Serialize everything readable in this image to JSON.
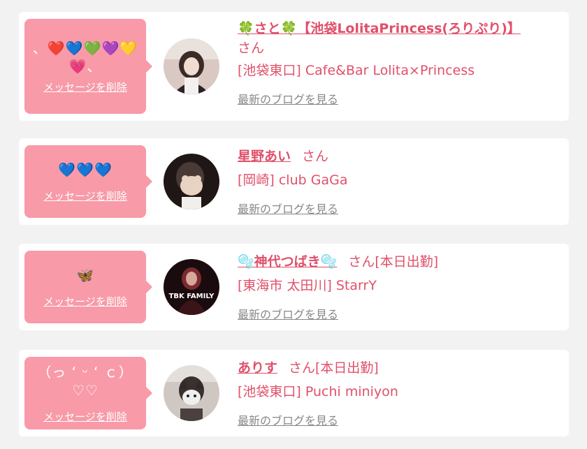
{
  "delete_label": "メッセージを削除",
  "blog_label": "最新のブログを見る",
  "colors": {
    "accent": "#e0506a",
    "bubble": "#f89aa8",
    "background": "#f2f2f3"
  },
  "items": [
    {
      "message": "、❤️💙💚💜💛 💗、",
      "name": "🍀さと🍀【池袋LolitaPrincess(ろりぷり)】",
      "honorific": "さん",
      "shop": "[池袋東口] Cafe&Bar Lolita×Princess"
    },
    {
      "message": "💙💙💙",
      "name": "星野あい",
      "honorific": "さん",
      "shop": "[岡崎] club GaGa"
    },
    {
      "message": "🦋",
      "name": "🫧神代つばき🫧",
      "honorific": "さん[本日出勤]",
      "shop": "[東海市 太田川] StarrY",
      "avatar_text": "TBK FAMILY"
    },
    {
      "message": "（っ ‘ ᵕ ‘ ｃ）♡♡",
      "name": "ありす",
      "honorific": "さん[本日出勤]",
      "shop": "[池袋東口] Puchi miniyon"
    }
  ]
}
